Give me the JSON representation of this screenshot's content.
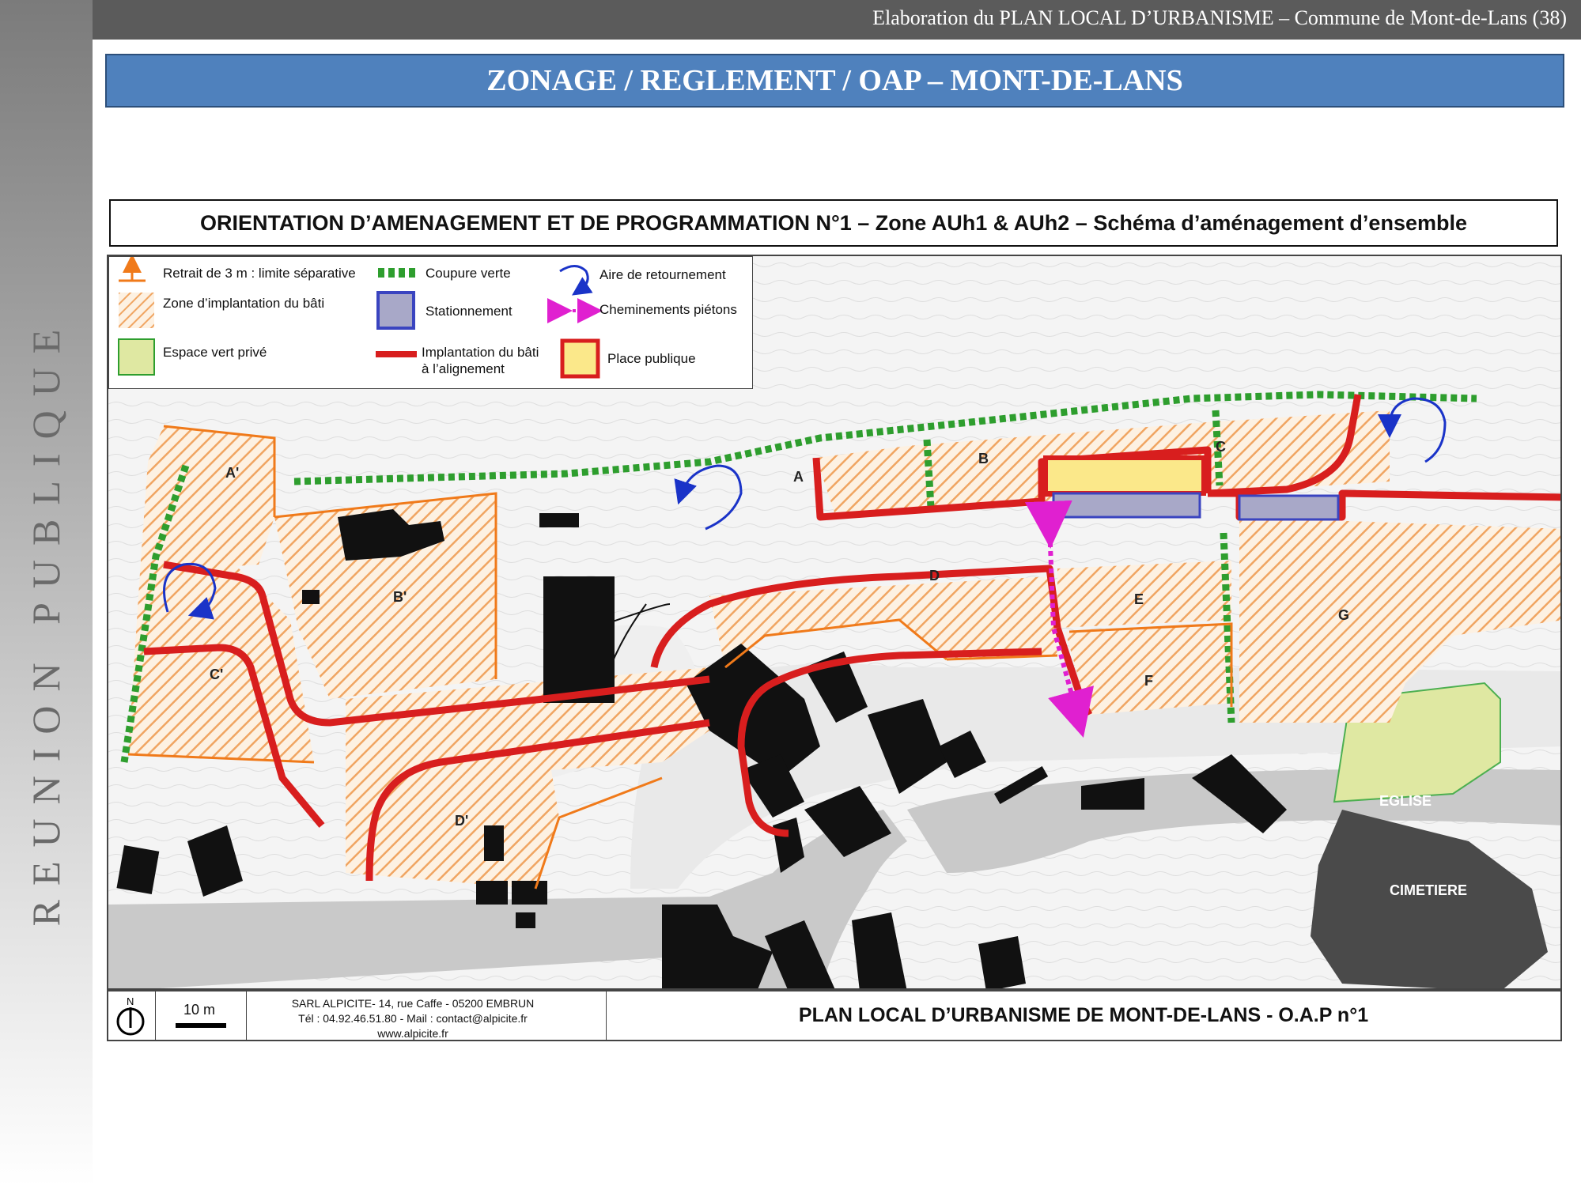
{
  "header": {
    "title": "Elaboration du PLAN LOCAL D’URBANISME – Commune  de Mont-de-Lans (38)"
  },
  "sidebar": {
    "label": "REUNION PUBLIQUE"
  },
  "banner": {
    "title": "ZONAGE / REGLEMENT / OAP – MONT-DE-LANS"
  },
  "map": {
    "title": "ORIENTATION D’AMENAGEMENT ET DE PROGRAMMATION N°1 – Zone AUh1 & AUh2 – Schéma d’aménagement d’ensemble",
    "legend": {
      "retrait": "Retrait de 3 m : limite séparative",
      "zone_bati": "Zone d’implantation du bâti",
      "espace_vert": "Espace vert privé",
      "coupure_verte": "Coupure verte",
      "stationnement": "Stationnement",
      "implantation_line1": "Implantation du bâti",
      "implantation_line2": "à l’alignement",
      "aire_retournement": "Aire de retournement",
      "cheminements": "Cheminements piétons",
      "place_publique": "Place publique"
    },
    "lots": [
      "A'",
      "B'",
      "C'",
      "D'",
      "A",
      "B",
      "C",
      "D",
      "E",
      "F",
      "G"
    ],
    "landmarks": {
      "eglise": "EGLISE",
      "cimetiere": "CIMETIERE"
    },
    "colors": {
      "hatch_orange": "#f4a460",
      "alignment_red": "#d81e1e",
      "green_break": "#2e9e2e",
      "parking": "#a8a8c8",
      "place_publique": "#fbe88a",
      "espace_vert": "#dfe8a2",
      "pedestrian": "#e020d0",
      "turnaround": "#1a33c8"
    }
  },
  "footer": {
    "north": "N",
    "scale": "10 m",
    "company_line1": "SARL ALPICITE- 14, rue Caffe - 05200 EMBRUN",
    "company_line2": "Tél : 04.92.46.51.80 - Mail : contact@alpicite.fr",
    "company_line3": "www.alpicite.fr",
    "plan_title": "PLAN LOCAL D’URBANISME DE MONT-DE-LANS - O.A.P n°1"
  }
}
